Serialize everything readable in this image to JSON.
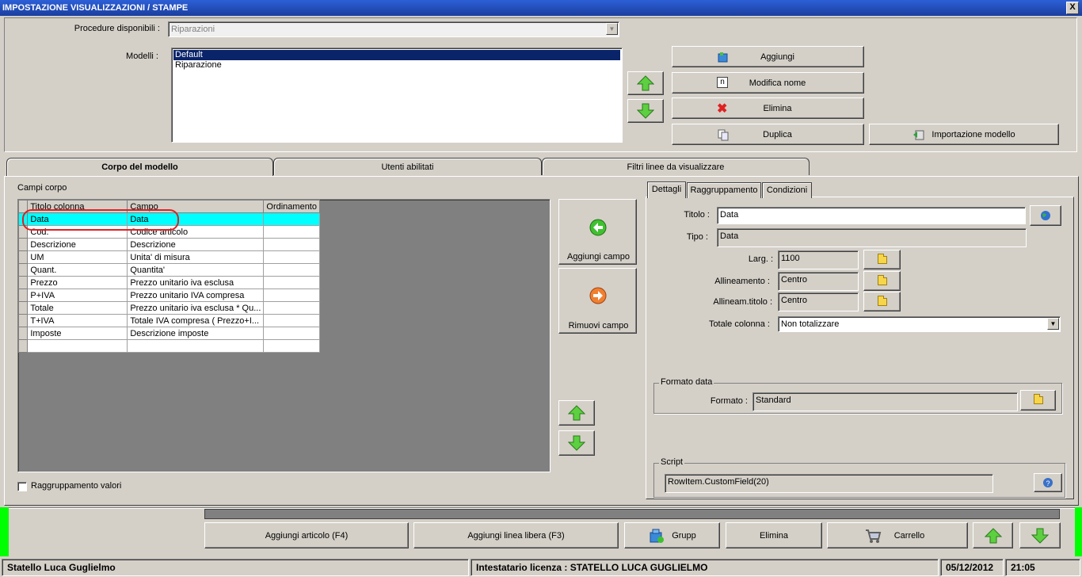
{
  "window": {
    "title": "IMPOSTAZIONE VISUALIZZAZIONI / STAMPE",
    "close_label": "X"
  },
  "top": {
    "procedure_label": "Procedure disponibili :",
    "procedure_value": "Riparazioni",
    "modelli_label": "Modelli :",
    "modelli": [
      "Default",
      "Riparazione"
    ],
    "buttons": {
      "aggiungi": "Aggiungi",
      "modifica_nome": "Modifica nome",
      "elimina": "Elimina",
      "duplica": "Duplica",
      "importazione": "Importazione modello"
    },
    "modifica_icon_glyph": "n"
  },
  "tabs": [
    "Corpo del modello",
    "Utenti abilitati",
    "Filtri linee da visualizzare"
  ],
  "campi": {
    "label": "Campi corpo",
    "headers": [
      "Titolo colonna",
      "Campo",
      "Ordinamento"
    ],
    "rows": [
      [
        "Data",
        "Data",
        ""
      ],
      [
        "Cod.",
        "Codice articolo",
        ""
      ],
      [
        "Descrizione",
        "Descrizione",
        ""
      ],
      [
        "UM",
        "Unita' di misura",
        ""
      ],
      [
        "Quant.",
        "Quantita'",
        ""
      ],
      [
        "Prezzo",
        "Prezzo unitario iva esclusa",
        ""
      ],
      [
        "P+IVA",
        "Prezzo unitario IVA compresa",
        ""
      ],
      [
        "Totale",
        "Prezzo unitario iva esclusa * Qu...",
        ""
      ],
      [
        "T+IVA",
        "Totale IVA compresa ( Prezzo+I...",
        ""
      ],
      [
        "Imposte",
        "Descrizione imposte",
        ""
      ],
      [
        "",
        "",
        ""
      ]
    ],
    "aggiungi_campo": "Aggiungi campo",
    "rimuovi_campo": "Rimuovi campo",
    "raggruppamento_valori": "Raggruppamento valori"
  },
  "detail_tabs": [
    "Dettagli",
    "Raggruppamento",
    "Condizioni"
  ],
  "dettagli": {
    "titolo_label": "Titolo :",
    "titolo_value": "Data",
    "tipo_label": "Tipo :",
    "tipo_value": "Data",
    "larg_label": "Larg. :",
    "larg_value": "1100",
    "allineamento_label": "Allineamento :",
    "allineamento_value": "Centro",
    "allineam_titolo_label": "Allineam.titolo :",
    "allineam_titolo_value": "Centro",
    "totale_label": "Totale colonna :",
    "totale_value": "Non totalizzare",
    "formato_group": "Formato data",
    "formato_label": "Formato :",
    "formato_value": "Standard",
    "script_group": "Script",
    "script_value": "RowItem.CustomField(20)"
  },
  "bottom": {
    "aggiungi_articolo": "Aggiungi articolo (F4)",
    "aggiungi_linea": "Aggiungi linea libera (F3)",
    "gruppo": "Grupp",
    "elimina": "Elimina",
    "carrello": "Carrello"
  },
  "status": {
    "user": "Statello Luca Guglielmo",
    "license": "Intestatario licenza : STATELLO LUCA GUGLIELMO",
    "date": "05/12/2012",
    "time": "21:05"
  },
  "colors": {
    "title_bar": "#1b3fa0",
    "selection": "#00ffff",
    "status_green": "#00ff00",
    "highlight_circle": "#e02020"
  }
}
